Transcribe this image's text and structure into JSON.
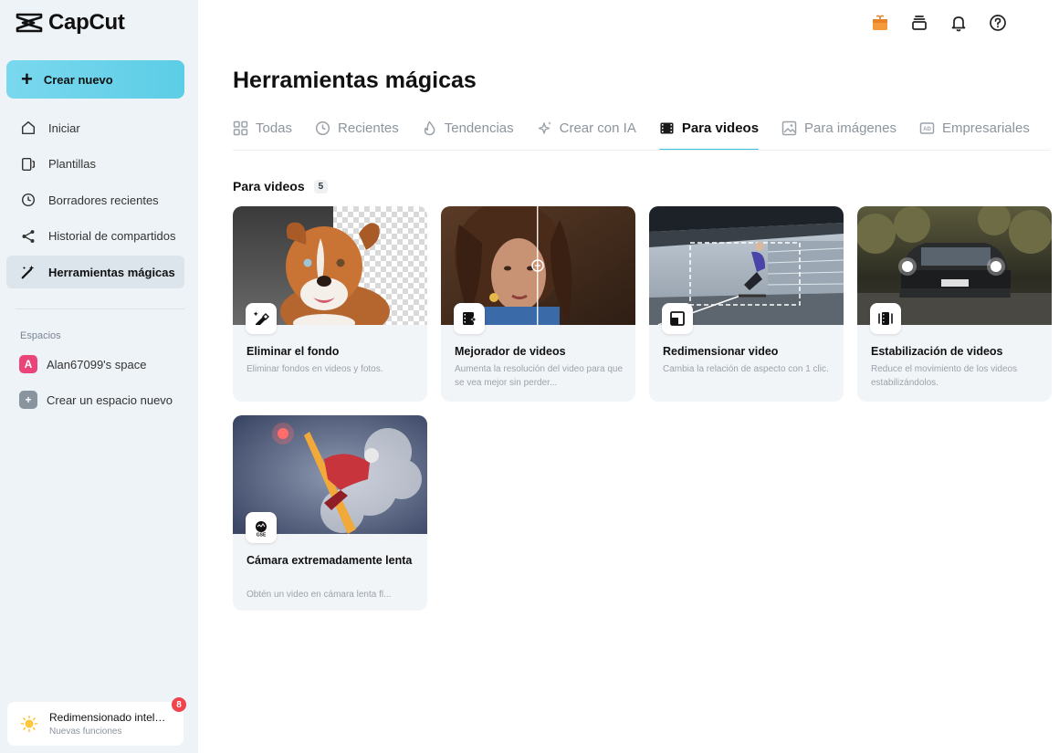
{
  "app": {
    "name": "CapCut"
  },
  "sidebar": {
    "create_label": "Crear nuevo",
    "items": [
      {
        "label": "Iniciar",
        "icon": "home-icon"
      },
      {
        "label": "Plantillas",
        "icon": "templates-icon"
      },
      {
        "label": "Borradores recientes",
        "icon": "clock-icon"
      },
      {
        "label": "Historial de compartidos",
        "icon": "share-icon"
      },
      {
        "label": "Herramientas mágicas",
        "icon": "magic-wand-icon",
        "active": true
      }
    ],
    "spaces_title": "Espacios",
    "spaces": [
      {
        "badge": "A",
        "label": "Alan67099's space",
        "color": "#e9457a"
      },
      {
        "badge": "+",
        "label": "Crear un espacio nuevo",
        "color": "#8a949e"
      }
    ],
    "news": {
      "title": "Redimensionado inteligente",
      "subtitle": "Nuevas funciones",
      "count": "8"
    }
  },
  "header": {
    "icons": [
      "gift-icon",
      "stack-icon",
      "bell-icon",
      "help-icon"
    ]
  },
  "main": {
    "title": "Herramientas mágicas",
    "tabs": [
      {
        "label": "Todas",
        "icon": "grid-icon"
      },
      {
        "label": "Recientes",
        "icon": "clock-icon"
      },
      {
        "label": "Tendencias",
        "icon": "flame-icon"
      },
      {
        "label": "Crear con IA",
        "icon": "sparkle-icon"
      },
      {
        "label": "Para videos",
        "icon": "film-icon",
        "active": true
      },
      {
        "label": "Para imágenes",
        "icon": "image-icon"
      },
      {
        "label": "Empresariales",
        "icon": "ad-icon"
      }
    ],
    "section": {
      "title": "Para videos",
      "count": "5"
    },
    "cards": [
      {
        "title": "Eliminar el fondo",
        "desc": "Eliminar fondos en videos y fotos.",
        "icon": "eraser-icon"
      },
      {
        "title": "Mejorador de videos",
        "desc": "Aumenta la resolución del video para que se vea mejor sin perder...",
        "icon": "enhance-icon"
      },
      {
        "title": "Redimensionar video",
        "desc": "Cambia la relación de aspecto con 1 clic.",
        "icon": "resize-icon"
      },
      {
        "title": "Estabilización de videos",
        "desc": "Reduce el movimiento de los videos estabilizándolos.",
        "icon": "stabilize-icon"
      },
      {
        "title": "Cámara extremadamente lenta",
        "desc": "Obtén un video en cámara lenta fl...",
        "icon": "slowmo-icon"
      }
    ]
  },
  "colors": {
    "accent": "#36c2dc",
    "create_button": "#6dd4ea",
    "sidebar_bg": "#eef3f7",
    "card_bg": "#f2f5f8",
    "badge_red": "#f0434b"
  }
}
